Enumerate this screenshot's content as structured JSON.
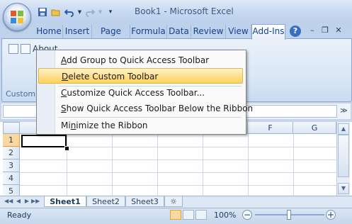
{
  "window": {
    "title": "Book1 - Microsoft Excel"
  },
  "ribbon": {
    "tabs": [
      "Home",
      "Insert",
      "Page Lay",
      "Formula",
      "Data",
      "Review",
      "View",
      "Add-Ins"
    ],
    "active_tab": "Add-Ins",
    "about_label": "About",
    "group_label": "Custom"
  },
  "context_menu": {
    "items": [
      {
        "label": "Add Group to Quick Access Toolbar",
        "mnemonic": "A"
      },
      {
        "label": "Delete Custom Toolbar",
        "mnemonic": "D",
        "highlighted": true
      },
      {
        "label": "Customize Quick Access Toolbar...",
        "mnemonic": "C"
      },
      {
        "label": "Show Quick Access Toolbar Below the Ribbon",
        "mnemonic": "S"
      },
      {
        "label": "Minimize the Ribbon",
        "mnemonic": "n"
      }
    ]
  },
  "grid": {
    "columns": [
      "F",
      "G"
    ],
    "rows": [
      "1",
      "2",
      "3",
      "4",
      "5"
    ],
    "active_cell": "A1"
  },
  "sheets": {
    "tabs": [
      "Sheet1",
      "Sheet2",
      "Sheet3"
    ],
    "active": "Sheet1"
  },
  "status": {
    "text": "Ready",
    "zoom": "100%"
  },
  "colors": {
    "menu_highlight": "#ffd25c",
    "ribbon_bg": "#dbe7f6",
    "accent": "#15428b"
  },
  "icons": [
    "office-button-icon",
    "save-icon",
    "open-icon",
    "undo-icon",
    "redo-icon",
    "qat-dropdown-icon",
    "help-icon",
    "minimize-icon",
    "restore-icon",
    "close-icon",
    "custom-toolbar-icon"
  ]
}
